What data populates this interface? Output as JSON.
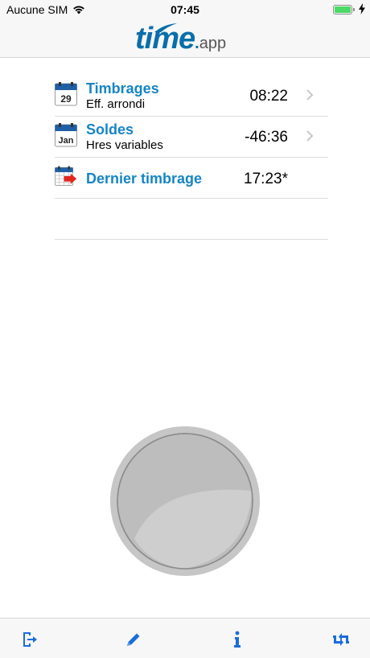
{
  "status_bar": {
    "carrier": "Aucune SIM",
    "time": "07:45",
    "battery_level": 1.0,
    "battery_color": "#4cd964"
  },
  "header": {
    "logo_main": "time",
    "logo_dot": ".",
    "logo_suffix": "app",
    "brand_color": "#0a6ea9"
  },
  "list": {
    "items": [
      {
        "title": "Timbrages",
        "subtitle": "Eff. arrondi",
        "value": "08:22",
        "icon": "calendar-29-icon",
        "icon_text": "29",
        "has_chevron": true
      },
      {
        "title": "Soldes",
        "subtitle": "Hres variables",
        "value": "-46:36",
        "icon": "calendar-jan-icon",
        "icon_text": "Jan",
        "has_chevron": true
      },
      {
        "title": "Dernier timbrage",
        "subtitle": "",
        "value": "17:23*",
        "icon": "calendar-arrow-icon",
        "has_chevron": false
      }
    ],
    "title_color": "#1585c5"
  },
  "main_button": {
    "icon": "clock-in-button"
  },
  "tab_bar": {
    "items": [
      {
        "icon": "logout-icon"
      },
      {
        "icon": "edit-pencil-icon"
      },
      {
        "icon": "info-icon"
      },
      {
        "icon": "sync-arrows-icon"
      }
    ],
    "tint_color": "#1a6ddb"
  }
}
